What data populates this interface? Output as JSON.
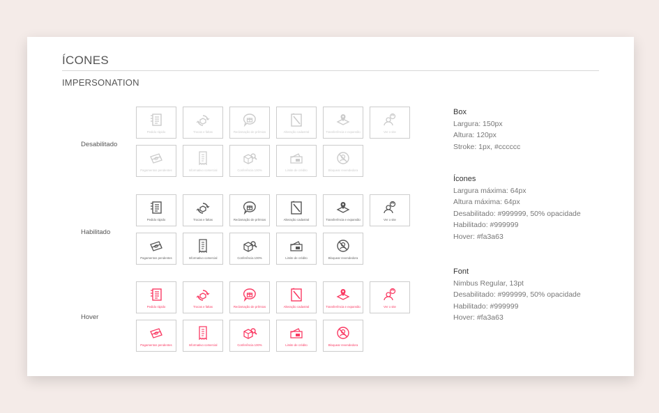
{
  "page": {
    "title": "ÍCONES",
    "subtitle": "IMPERSONATION"
  },
  "states": [
    {
      "label": "Desabilitado"
    },
    {
      "label": "Habilitado"
    },
    {
      "label": "Hover"
    }
  ],
  "icons": [
    {
      "name": "receipt-list-icon",
      "label": "Pedido rápido"
    },
    {
      "name": "box-refresh-icon",
      "label": "Trocas e faltas"
    },
    {
      "name": "speech-gift-icon",
      "label": "Reclamação de prêmios"
    },
    {
      "name": "document-edit-icon",
      "label": "Alteração cadastral"
    },
    {
      "name": "map-pin-icon",
      "label": "Transferência e expansão"
    },
    {
      "name": "user-search-icon",
      "label": "Ver o site"
    },
    {
      "name": "money-bills-icon",
      "label": "Pagamentos pendentes"
    },
    {
      "name": "receipt-icon",
      "label": "Informativo comercial"
    },
    {
      "name": "box-magnify-icon",
      "label": "Conferência 100%"
    },
    {
      "name": "wallet-card-icon",
      "label": "Limite de crédito"
    },
    {
      "name": "user-blocked-icon",
      "label": "Bloquear revendedora"
    }
  ],
  "colors": {
    "disabled": "#999999",
    "enabled": "#999999",
    "hover": "#fa3a63",
    "stroke": "#cccccc"
  },
  "specs": {
    "box": {
      "title": "Box",
      "lines": [
        "Largura: 150px",
        "Altura: 120px",
        "Stroke: 1px, #cccccc"
      ]
    },
    "icons": {
      "title": "Ícones",
      "lines": [
        "Largura máxima: 64px",
        "Altura máxima: 64px",
        "Desabilitado: #999999, 50% opacidade",
        "Habilitado: #999999",
        "Hover: #fa3a63"
      ]
    },
    "font": {
      "title": "Font",
      "lines": [
        "Nimbus Regular, 13pt",
        "Desabilitado: #999999, 50% opacidade",
        "Habilitado: #999999",
        "Hover: #fa3a63"
      ]
    }
  }
}
